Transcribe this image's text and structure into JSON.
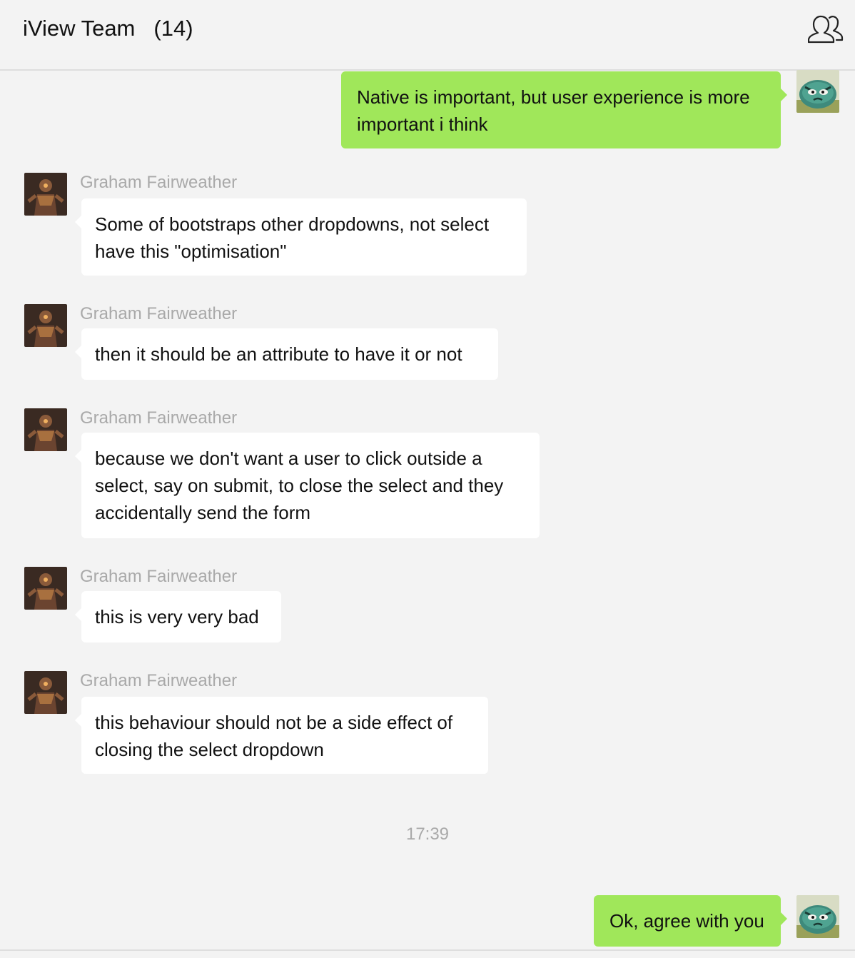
{
  "header": {
    "title": "iView Team",
    "count": "(14)",
    "members_icon": "group-members-icon"
  },
  "messages": [
    {
      "side": "right",
      "text": "Native is important, but user experience is more\nimportant i think"
    },
    {
      "side": "left",
      "sender": "Graham Fairweather",
      "text": "Some of bootstraps other dropdowns, not select\nhave this \"optimisation\""
    },
    {
      "side": "left",
      "sender": "Graham Fairweather",
      "text": "then it should be an attribute to have it or not"
    },
    {
      "side": "left",
      "sender": "Graham Fairweather",
      "text": "because we don't want a user to click outside a\nselect, say on submit, to close the select and they\naccidentally send the form"
    },
    {
      "side": "left",
      "sender": "Graham Fairweather",
      "text": "this is very very bad"
    },
    {
      "side": "left",
      "sender": "Graham Fairweather",
      "text": "this behaviour should not be a side effect of\nclosing the select dropdown"
    },
    {
      "side": "right",
      "text": "Ok, agree with you"
    }
  ],
  "timestamp": "17:39",
  "colors": {
    "background": "#f3f3f3",
    "own_bubble": "#a0e75a",
    "other_bubble": "#ffffff",
    "muted_text": "#a9a9a9"
  }
}
